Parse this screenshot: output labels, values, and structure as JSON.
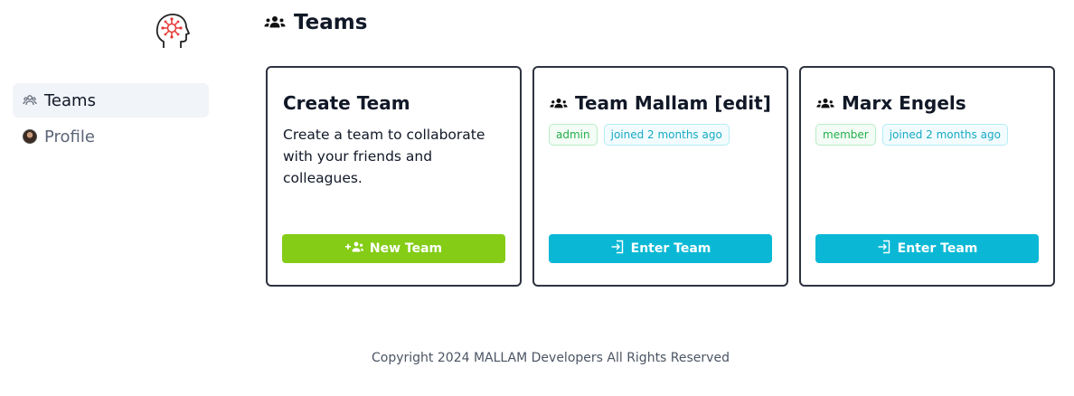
{
  "colors": {
    "logo_accent": "#e53935",
    "new_team_button": "#84cc16",
    "enter_team_button": "#0ab8d5",
    "badge_green": "#22b04b",
    "badge_cyan": "#17a9c4",
    "sidebar_active_bg": "#f1f4f8"
  },
  "sidebar": {
    "logo_icon": "head-circuit-icon",
    "items": [
      {
        "label": "Teams",
        "icon": "users-icon",
        "active": true
      },
      {
        "label": "Profile",
        "icon": "avatar",
        "active": false
      }
    ]
  },
  "header": {
    "title": "Teams",
    "icon": "users-icon"
  },
  "cards": {
    "create": {
      "title": "Create Team",
      "description": "Create a team to collaborate with your friends and colleagues.",
      "button_label": "New Team",
      "button_icon": "user-plus-icon"
    },
    "teams": [
      {
        "title": "Team Mallam [edit]",
        "role": "admin",
        "joined": "joined 2 months ago",
        "button_label": "Enter Team",
        "button_icon": "sign-in-icon"
      },
      {
        "title": "Marx Engels",
        "role": "member",
        "joined": "joined 2 months ago",
        "button_label": "Enter Team",
        "button_icon": "sign-in-icon"
      }
    ]
  },
  "footer": {
    "text": "Copyright 2024 MALLAM Developers All Rights Reserved"
  }
}
